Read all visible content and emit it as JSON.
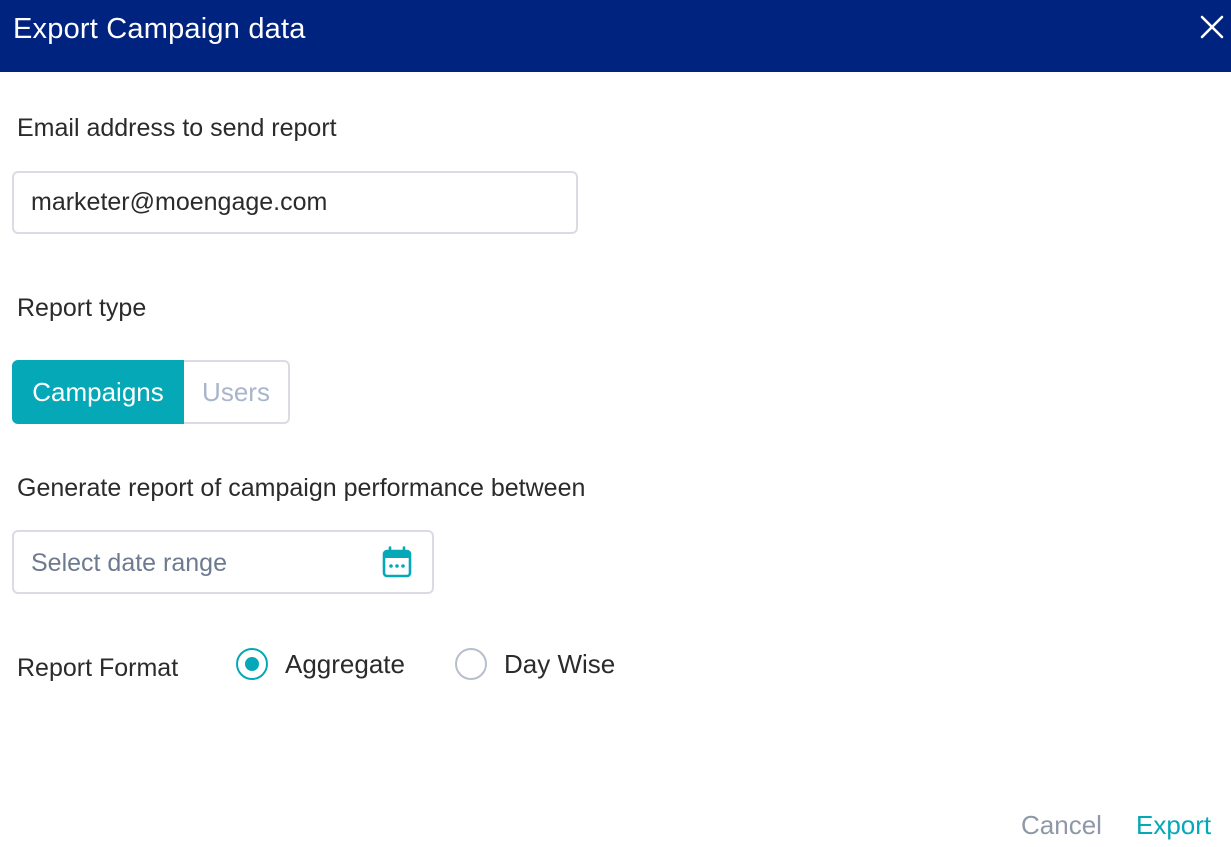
{
  "dialog": {
    "title": "Export Campaign data",
    "close_icon": "close-icon"
  },
  "email": {
    "label": "Email address to send report",
    "value": "marketer@moengage.com"
  },
  "report_type": {
    "label": "Report type",
    "options": [
      {
        "label": "Campaigns",
        "selected": true
      },
      {
        "label": "Users",
        "selected": false
      }
    ]
  },
  "date_range": {
    "label": "Generate report of campaign performance between",
    "placeholder": "Select date range",
    "icon": "calendar-icon"
  },
  "report_format": {
    "label": "Report Format",
    "options": [
      {
        "label": "Aggregate",
        "selected": true
      },
      {
        "label": "Day Wise",
        "selected": false
      }
    ]
  },
  "footer": {
    "cancel_label": "Cancel",
    "export_label": "Export"
  },
  "colors": {
    "header_bg": "#00237f",
    "accent": "#05a8b7",
    "muted": "#8f98a8"
  }
}
